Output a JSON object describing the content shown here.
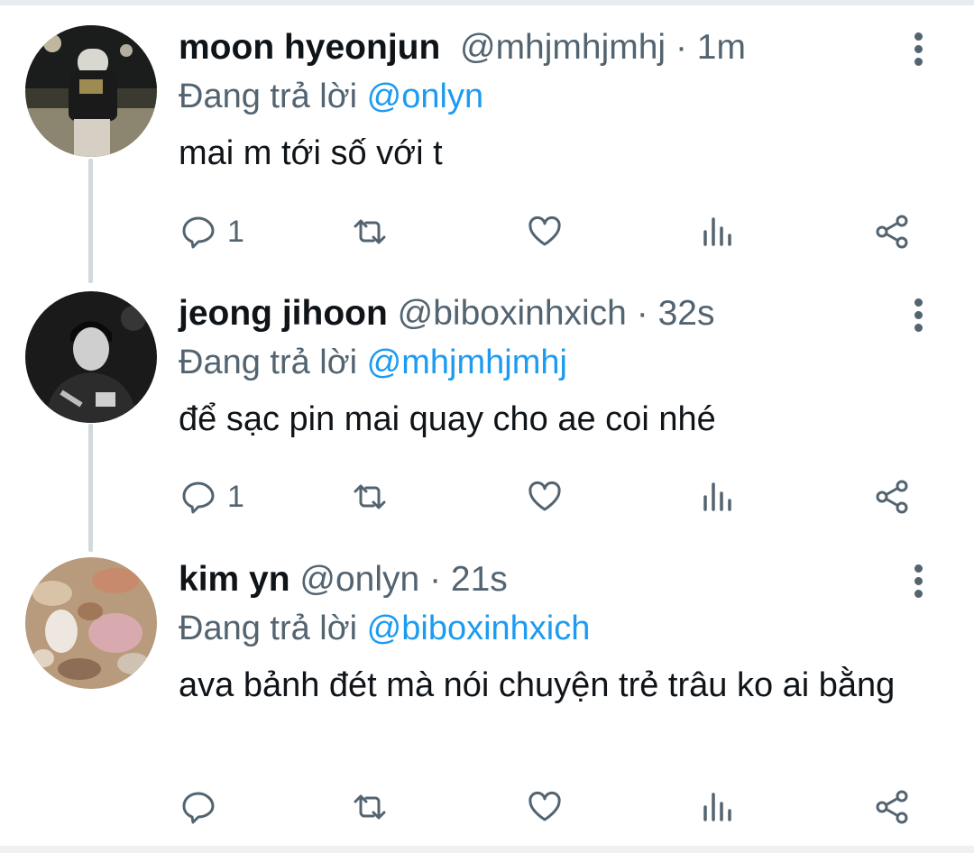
{
  "tweets": [
    {
      "name": "moon hyeonjun",
      "handle": "@mhjmhjmhj",
      "sep": "·",
      "time": "1m",
      "replying_prefix": "Đang trả lời",
      "replying_to": "@onlyn",
      "text": "mai m tới số với t",
      "reply_count": "1",
      "avatar": "night-street-photo"
    },
    {
      "name": "jeong jihoon",
      "handle": "@biboxinhxich",
      "sep": "·",
      "time": "32s",
      "replying_prefix": "Đang trả lời",
      "replying_to": "@mhjmhjmhj",
      "text": "để sạc pin mai quay cho ae coi nhé",
      "reply_count": "1",
      "avatar": "monochrome-portrait"
    },
    {
      "name": "kim yn",
      "handle": "@onlyn",
      "sep": "·",
      "time": "21s",
      "replying_prefix": "Đang trả lời",
      "replying_to": "@biboxinhxich",
      "text": "ava bảnh đét mà nói chuyện trẻ trâu ko ai bằng",
      "reply_count": "",
      "avatar": "seashells"
    }
  ],
  "icons": [
    "reply-icon",
    "retweet-icon",
    "like-icon",
    "views-icon",
    "share-icon",
    "more-icon"
  ],
  "colors": {
    "text": "#0f1419",
    "muted": "#536471",
    "link": "#1d9bf0",
    "thread_line": "#cfd9de"
  }
}
